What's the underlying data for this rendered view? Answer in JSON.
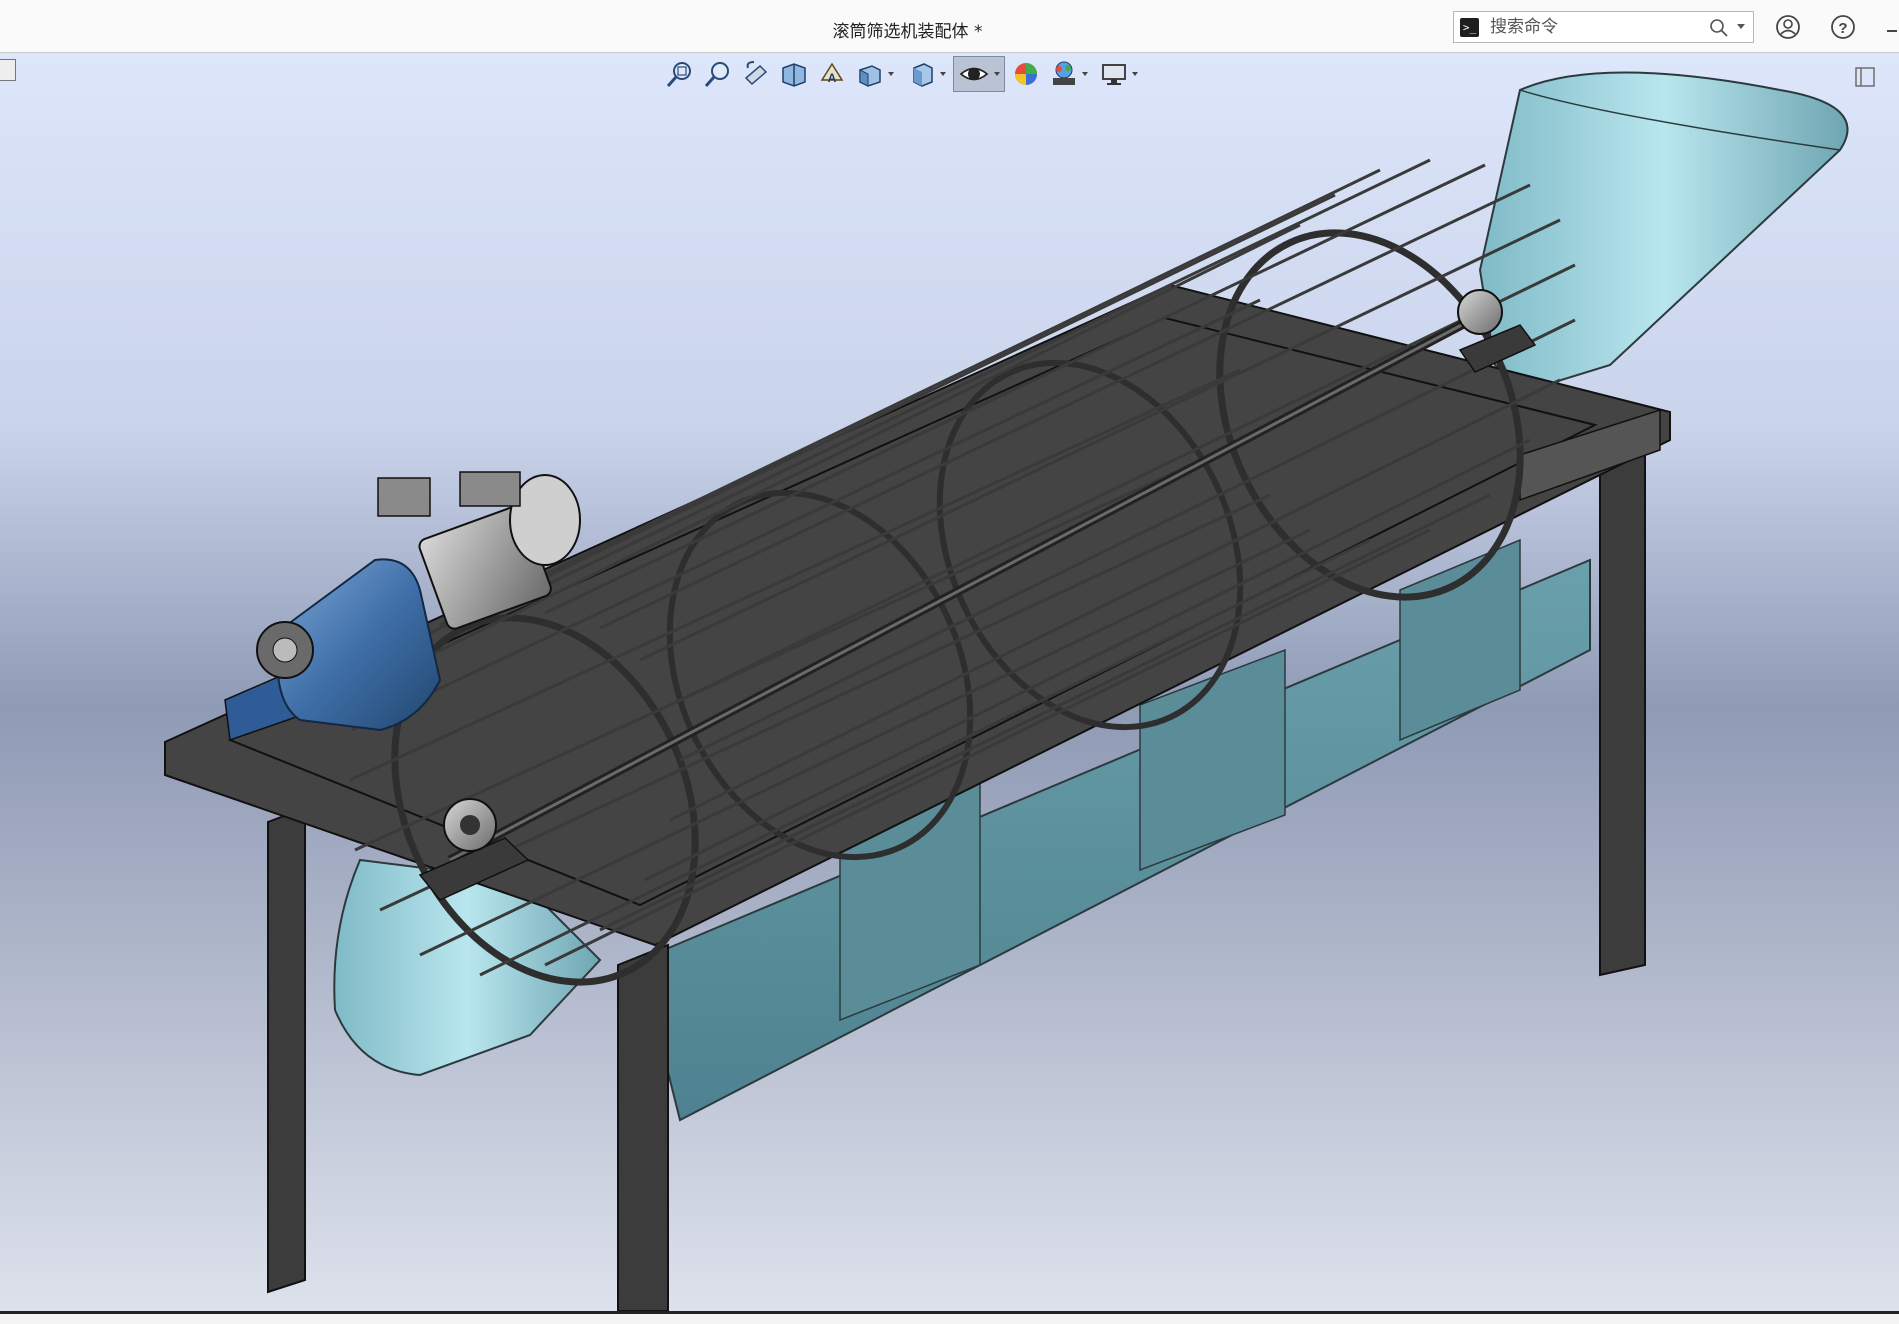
{
  "window": {
    "title": "滚筒筛选机装配体 *"
  },
  "search": {
    "placeholder": "搜索命令",
    "icon": "search-icon",
    "terminal_icon": "command-prompt-icon"
  },
  "titlebar_icons": [
    "user-account-icon",
    "help-icon"
  ],
  "heads_up_toolbar": {
    "tools": [
      "zoom-to-fit-icon",
      "zoom-to-area-icon",
      "previous-view-icon",
      "section-view-icon",
      "dynamic-annotation-views-icon",
      "view-orientation-icon",
      "display-style-icon",
      "hide-show-items-icon",
      "edit-appearance-icon",
      "apply-scene-icon",
      "view-settings-icon"
    ],
    "active": "hide-show-items-icon"
  },
  "model": {
    "name": "滚筒筛选机装配体",
    "colors": {
      "frame": "#3c3c3c",
      "chute": "#6a9ea8",
      "hopper": "#9fd4dd",
      "motor": "#3f6fa8",
      "drum": "#2e2e2e"
    }
  }
}
